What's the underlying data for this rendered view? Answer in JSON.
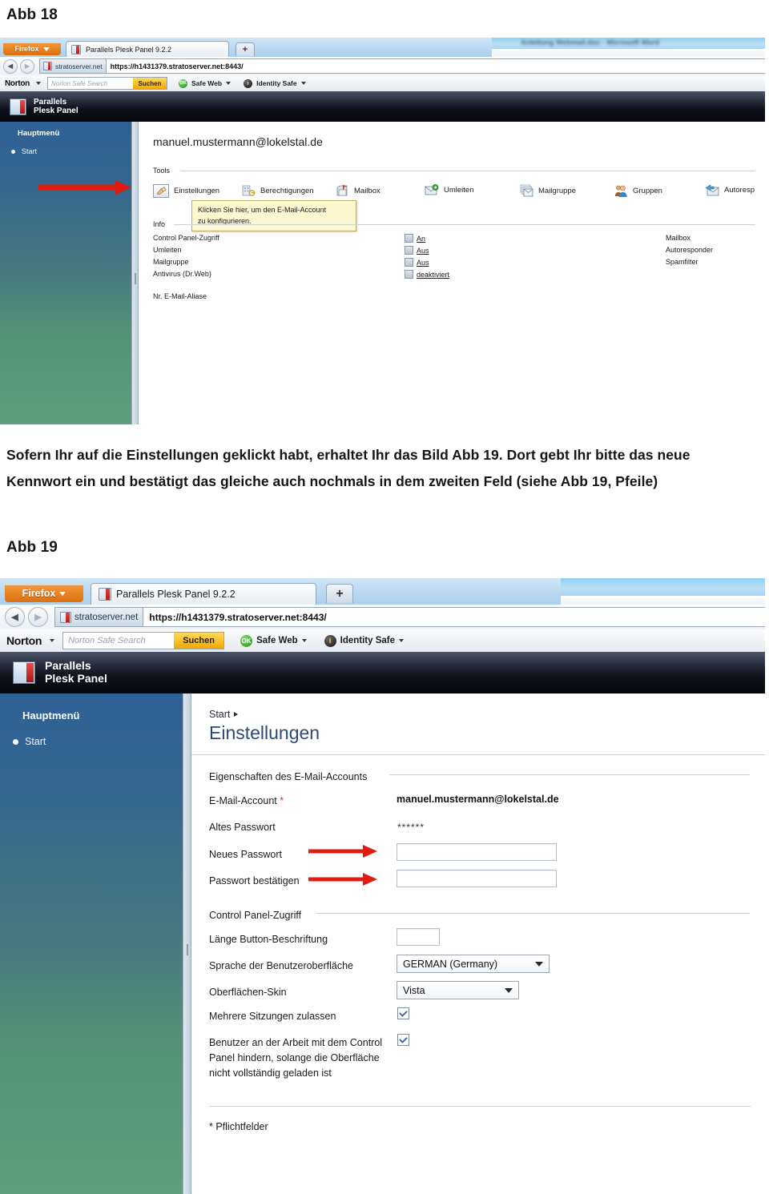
{
  "doc": {
    "caption_1": "Abb 18",
    "caption_2": "Abb 19",
    "paragraph": "Sofern Ihr auf die Einstellungen geklickt habt, erhaltet Ihr das Bild Abb 19. Dort gebt Ihr bitte das neue Kennwort ein und bestätigt das gleiche auch nochmals in dem zweiten Feld (siehe Abb 19, Pfeile)"
  },
  "browser": {
    "firefox_button": "Firefox",
    "tab_title": "Parallels Plesk Panel 9.2.2",
    "new_tab": "+",
    "back_arrow": "◀",
    "forward_arrow": "▶",
    "site_chip": "stratoserver.net",
    "url": "https://h1431379.stratoserver.net:8443/",
    "norton": {
      "logo": "Norton",
      "search_placeholder": "Norton Safe Search",
      "search_value": "",
      "search_button": "Suchen",
      "safe_web": "Safe Web",
      "safe_web_badge": "OK",
      "identity_safe": "Identity Safe",
      "identity_badge": "i"
    }
  },
  "plesk": {
    "brand_line1": "Parallels",
    "brand_line2": "Plesk Panel",
    "sidebar": {
      "title": "Hauptmenü",
      "items": [
        "Start"
      ]
    }
  },
  "background_window": {
    "title": "Anleitung Webmail.doc - Microsoft Word"
  },
  "abb18": {
    "account_title": "manuel.mustermann@lokelstal.de",
    "tools_label": "Tools",
    "tools": [
      {
        "label": "Einstellungen",
        "icon": "settings-hand-icon"
      },
      {
        "label": "Berechtigungen",
        "icon": "permissions-icon"
      },
      {
        "label": "Mailbox",
        "icon": "mailbox-icon"
      },
      {
        "label": "Umleiten",
        "icon": "redirect-icon"
      },
      {
        "label": "Mailgruppe",
        "icon": "mailgroup-icon"
      },
      {
        "label": "Gruppen",
        "icon": "groups-icon"
      },
      {
        "label": "Autoresp",
        "icon": "autoresponder-icon"
      }
    ],
    "tooltip_line1": "Klicken Sie hier, um den E-Mail-Account",
    "tooltip_line2": "zu konfigurieren.",
    "info_label": "Info",
    "info_rows": [
      {
        "name": "Control Panel-Zugriff",
        "value": "An"
      },
      {
        "name": "Umleiten",
        "value": "Aus"
      },
      {
        "name": "Mailgruppe",
        "value": "Aus"
      },
      {
        "name": "Antivirus (Dr.Web)",
        "value": "deaktiviert"
      }
    ],
    "aliases_label": "Nr. E-Mail-Aliase",
    "right_column": [
      "Mailbox",
      "Autoresponder",
      "Spamfilter"
    ]
  },
  "abb19": {
    "breadcrumb": "Start",
    "heading": "Einstellungen",
    "section_account": "Eigenschaften des E-Mail-Accounts",
    "fields": {
      "email_label": "E-Mail-Account",
      "email_value": "manuel.mustermann@lokelstal.de",
      "old_password_label": "Altes Passwort",
      "old_password_value": "******",
      "new_password_label": "Neues Passwort",
      "new_password_value": "",
      "confirm_password_label": "Passwort bestätigen",
      "confirm_password_value": ""
    },
    "section_cp": "Control Panel-Zugriff",
    "cp": {
      "button_length_label": "Länge Button-Beschriftung",
      "button_length_value": "",
      "language_label": "Sprache der Benutzeroberfläche",
      "language_value": "GERMAN (Germany)",
      "skin_label": "Oberflächen-Skin",
      "skin_value": "Vista",
      "multi_session_label": "Mehrere Sitzungen zulassen",
      "multi_session_checked": true,
      "prevent_label": "Benutzer an der Arbeit mit dem Control Panel hindern, solange die Oberfläche nicht vollständig geladen ist",
      "prevent_checked": true
    },
    "required_note": "* Pflichtfelder"
  },
  "colors": {
    "accent_red": "#e21b11",
    "firefox_orange": "#dd6f10",
    "norton_yellow": "#f0a900",
    "heading_blue": "#2b4a75",
    "sidebar_top": "#2f6096",
    "sidebar_bottom": "#5c9e7d"
  }
}
